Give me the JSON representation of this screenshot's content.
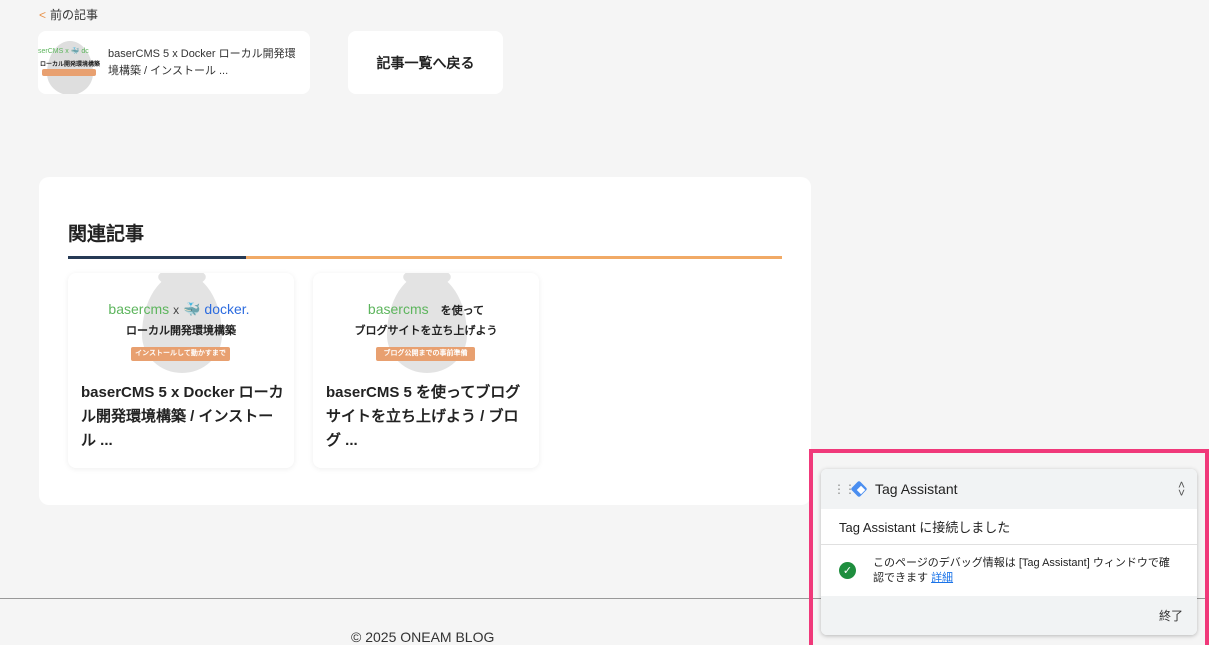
{
  "nav": {
    "prev_chevron": "<",
    "prev_label": "前の記事",
    "prev_card": {
      "thumb_logo": "serCMS x 🐳 dc",
      "thumb_sub": "ローカル開発環境構築",
      "title": "baserCMS 5 x Docker ローカル開発環境構築 / インストール ..."
    },
    "back_label": "記事一覧へ戻る"
  },
  "related": {
    "heading": "関連記事",
    "cards": [
      {
        "logo_left": "basercms",
        "logo_x": "x",
        "logo_right": "🐳 docker.",
        "logo_suffix": "",
        "subtitle": "ローカル開発環境構築",
        "tag": "インストールして動かすまで",
        "title": "baserCMS 5 x Docker ローカル開発環境構築 / インストール ..."
      },
      {
        "logo_left": "basercms",
        "logo_x": "",
        "logo_right": "",
        "logo_suffix": "を使って",
        "subtitle": "ブログサイトを立ち上げよう",
        "tag": "ブログ公開までの事前準備",
        "title": "baserCMS 5 を使ってブログサイトを立ち上げよう / ブログ ..."
      }
    ]
  },
  "footer": {
    "copyright": "© 2025 ONEAM BLOG"
  },
  "tag_assistant": {
    "grip": "⋮⋮",
    "title": "Tag Assistant",
    "collapse": "˄\n˅",
    "connected": "Tag Assistant に接続しました",
    "check": "✓",
    "message": "このページのデバッグ情報は [Tag Assistant] ウィンドウで確認できます",
    "detail_link": "詳細",
    "close": "終了",
    "highlight_color": "#f0397a"
  },
  "colors": {
    "accent_orange": "#f1aa66",
    "accent_navy": "#263a55",
    "baser_green": "#5db55d",
    "docker_blue": "#2d6cdf"
  }
}
